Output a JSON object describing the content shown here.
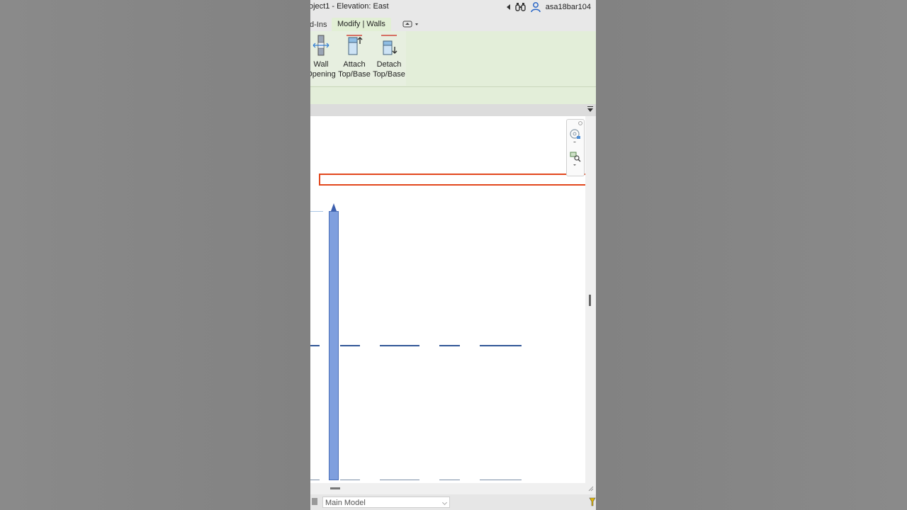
{
  "window": {
    "title": "oject1 - Elevation: East",
    "user": "asa18bar104"
  },
  "tabs": [
    {
      "label": "d-Ins"
    },
    {
      "label": "Modify | Walls"
    }
  ],
  "ribbon": {
    "buttons": [
      {
        "line1": "Wall",
        "line2": "Opening"
      },
      {
        "line1": "Attach",
        "line2": "Top/Base"
      },
      {
        "line1": "Detach",
        "line2": "Top/Base"
      }
    ]
  },
  "status": {
    "model": "Main Model"
  },
  "colors": {
    "ribbon_bg": "#e3eed9",
    "active_tab": "#e2efd5",
    "wall": "#7f9fde",
    "highlight": "#e2471d"
  }
}
